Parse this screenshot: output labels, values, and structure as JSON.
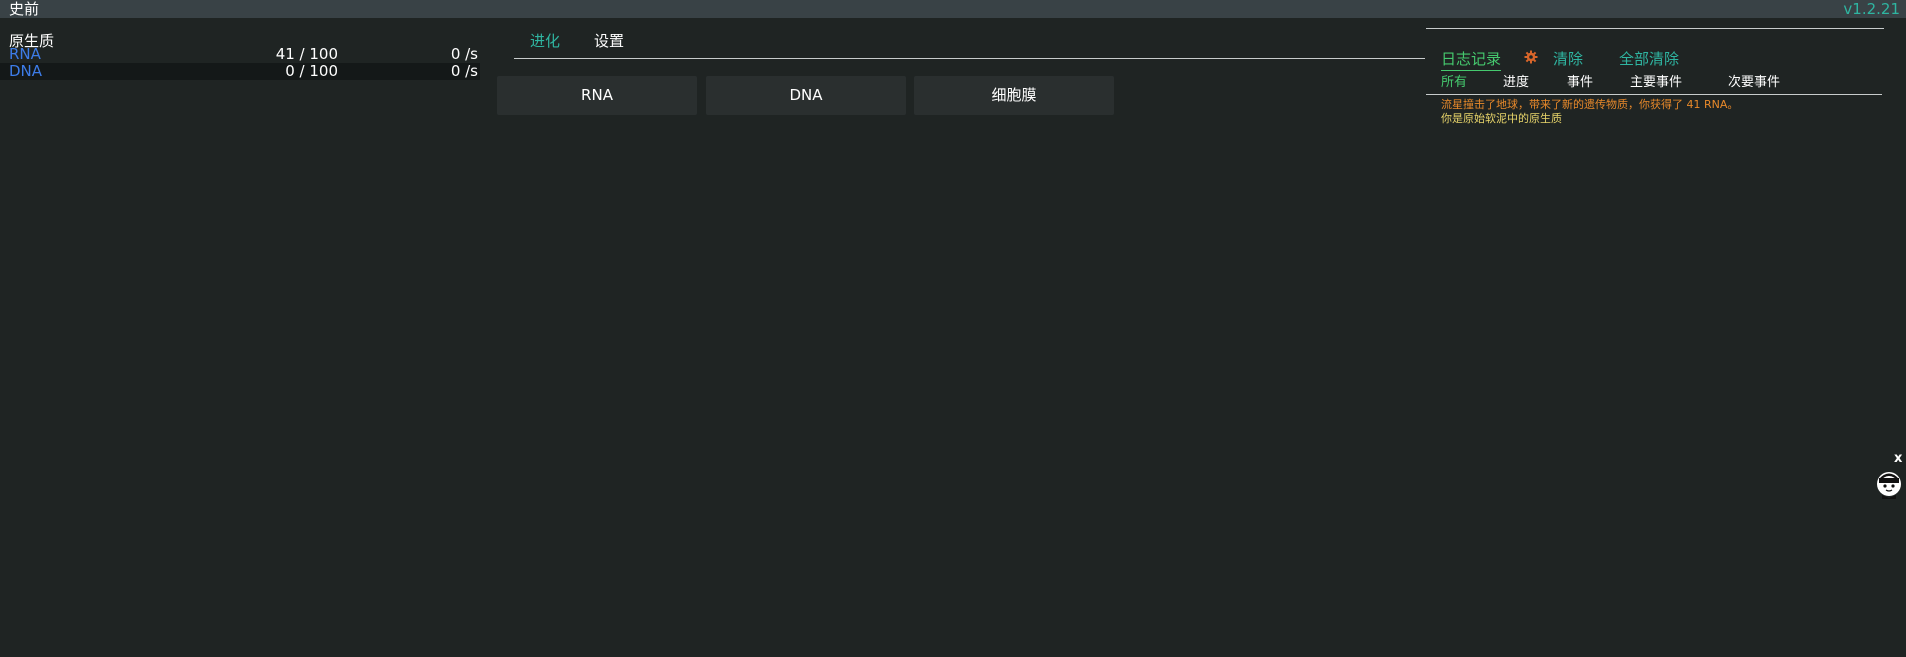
{
  "header": {
    "era": "史前",
    "version": "v1.2.21"
  },
  "resources": {
    "category": "原生质",
    "items": [
      {
        "name": "RNA",
        "amount": "41 / 100",
        "rate": "0 /s"
      },
      {
        "name": "DNA",
        "amount": "0 / 100",
        "rate": "0 /s"
      }
    ]
  },
  "tabs": {
    "evolution": "进化",
    "settings": "设置"
  },
  "actions": {
    "rna": "RNA",
    "dna": "DNA",
    "membrane": "细胞膜"
  },
  "log": {
    "title": "日志记录",
    "clear": "清除",
    "clear_all": "全部清除",
    "filters": {
      "all": "所有",
      "progress": "进度",
      "events": "事件",
      "major": "主要事件",
      "minor": "次要事件"
    },
    "messages": [
      "流星撞击了地球，带来了新的遗传物质，你获得了 41 RNA。",
      "你是原始软泥中的原生质"
    ]
  },
  "floating": {
    "close": "x"
  },
  "colors": {
    "accent": "#2fb5a1",
    "active_green": "#45c96e",
    "resource_blue": "#3d7ce8",
    "msg_orange": "#e8892a",
    "msg_yellow": "#e8d56a"
  }
}
